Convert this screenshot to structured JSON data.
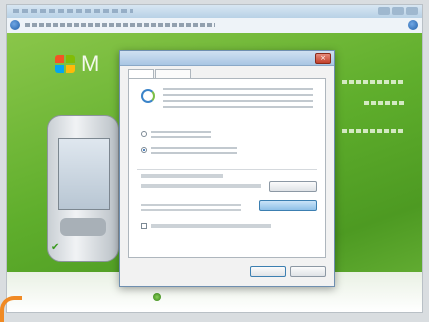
{
  "window": {
    "colors": {
      "accent": "#5fae2c",
      "titlebar": "#b8d1e6",
      "dialog_border": "#6f8fb0"
    }
  },
  "background_page": {
    "brand_letter": "M"
  },
  "dialog": {
    "close_glyph": "×",
    "icons": [
      "sync-icon",
      "close-icon",
      "check-icon",
      "back-icon",
      "help-icon"
    ]
  }
}
